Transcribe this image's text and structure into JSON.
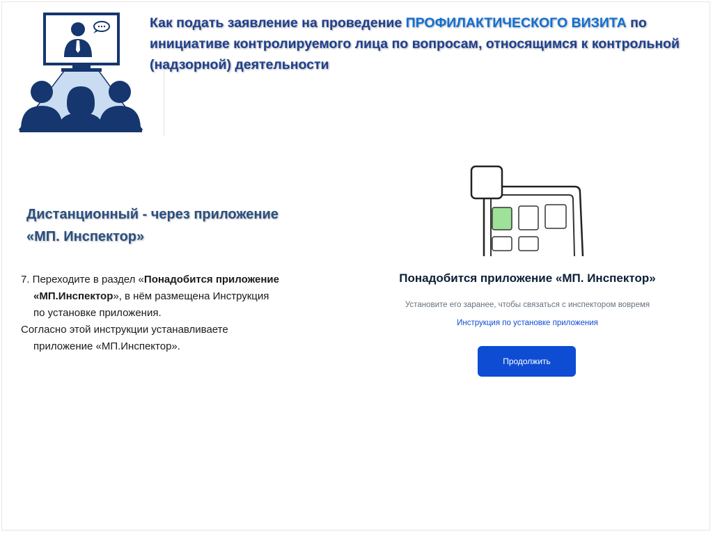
{
  "title": {
    "part1": "Как подать заявление на проведение ",
    "accent": "ПРОФИЛАКТИЧЕСКОГО ВИЗИТА",
    "part2": " по инициативе контролируемого лица  по вопросам, относящимся к контрольной (надзорной) деятельности"
  },
  "method": {
    "line1": "Дистанционный - через приложение",
    "line2": "«МП. Инспектор»"
  },
  "instructions": {
    "step_prefix": "7. Переходите в раздел «",
    "step_bold1": "Понадобится приложение",
    "step_bold2": "«МП.Инспектор",
    "step_suffix1": "»,   в нём размещена Инструкция",
    "step_suffix2": "по установке приложения.",
    "line2a": "Согласно этой инструкции устанавливаете",
    "line2b": "приложение  «МП.Инспектор»."
  },
  "app_screen": {
    "title": "Понадобится приложение «МП. Инспектор»",
    "subtitle": "Установите его заранее, чтобы связаться с инспектором вовремя",
    "link": "Инструкция по установке приложения",
    "button": "Продолжить"
  },
  "colors": {
    "title": "#1f3f8f",
    "accent": "#0f6fd6",
    "heading": "#2a4f7f",
    "button": "#0d4cd3",
    "link": "#0d4cd3",
    "illustration_navy": "#15366e",
    "illustration_light": "#c9dcf2"
  },
  "icons": {
    "illustration": "video-conference-icon",
    "phone": "phone-app-icon"
  }
}
